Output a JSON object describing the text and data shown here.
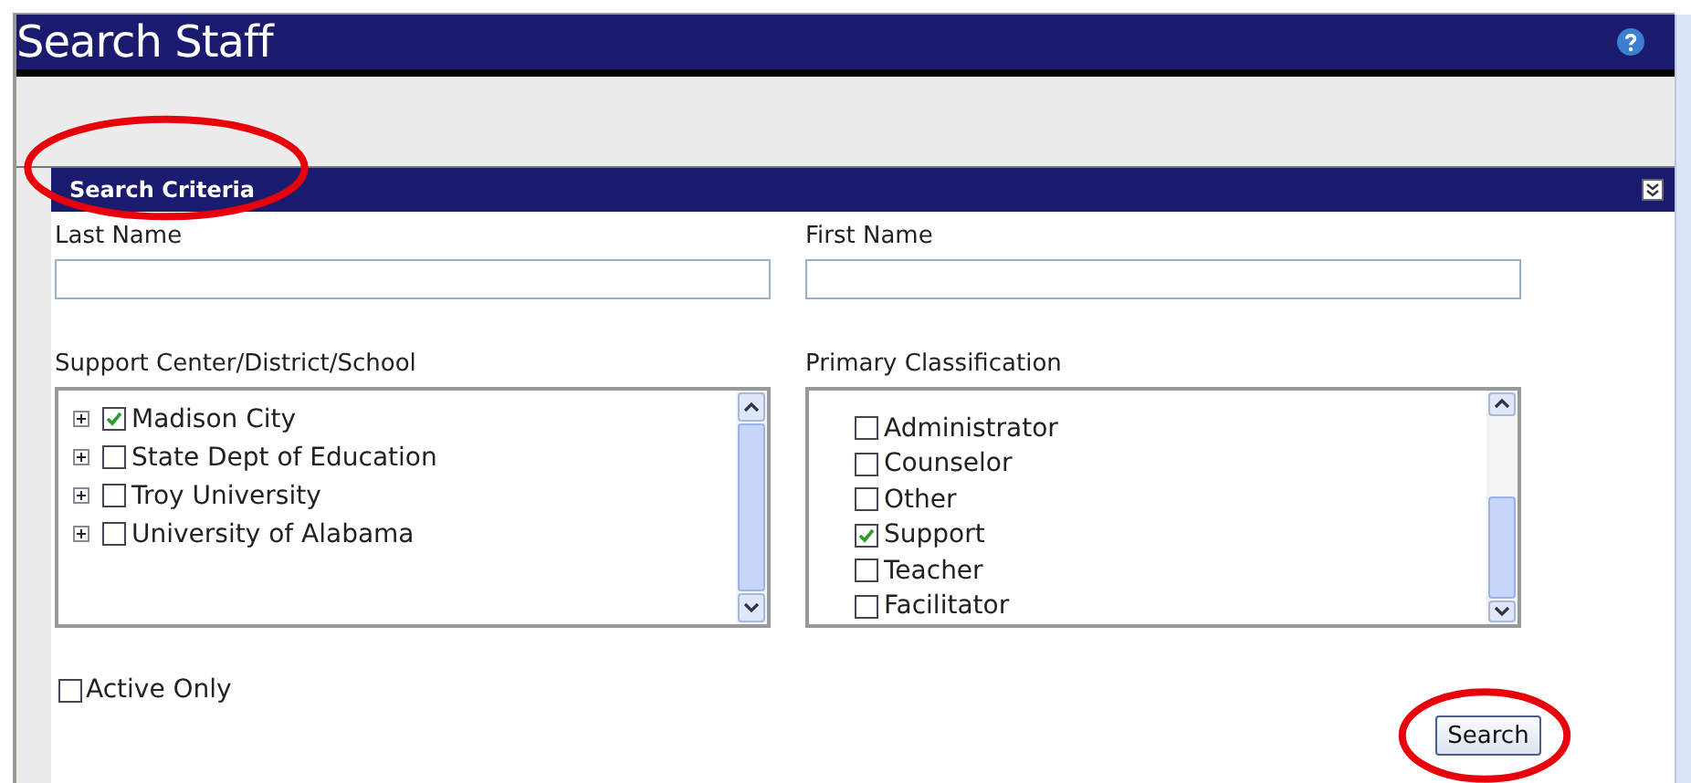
{
  "page": {
    "title": "Search Staff"
  },
  "section": {
    "title": "Search Criteria",
    "circled": true
  },
  "fields": [
    {
      "label": "Last Name"
    },
    {
      "label": "First Name"
    }
  ],
  "tree": {
    "label": "Support Center/District/School",
    "items": [
      {
        "label": "Madison City",
        "checked": true
      },
      {
        "label": "State Dept of Education",
        "checked": false
      },
      {
        "label": "Troy University",
        "checked": false
      },
      {
        "label": "University of Alabama",
        "checked": false
      }
    ]
  },
  "classification": {
    "label": "Primary Classification",
    "items": [
      {
        "label": "Administrator",
        "checked": false
      },
      {
        "label": "Counselor",
        "checked": false
      },
      {
        "label": "Other",
        "checked": false
      },
      {
        "label": "Support",
        "checked": true
      },
      {
        "label": "Teacher",
        "checked": false
      },
      {
        "label": "Facilitator",
        "checked": false
      }
    ]
  },
  "active_only": {
    "label": "Active Only",
    "checked": false
  },
  "search_button": {
    "label": "Search",
    "circled": true
  }
}
